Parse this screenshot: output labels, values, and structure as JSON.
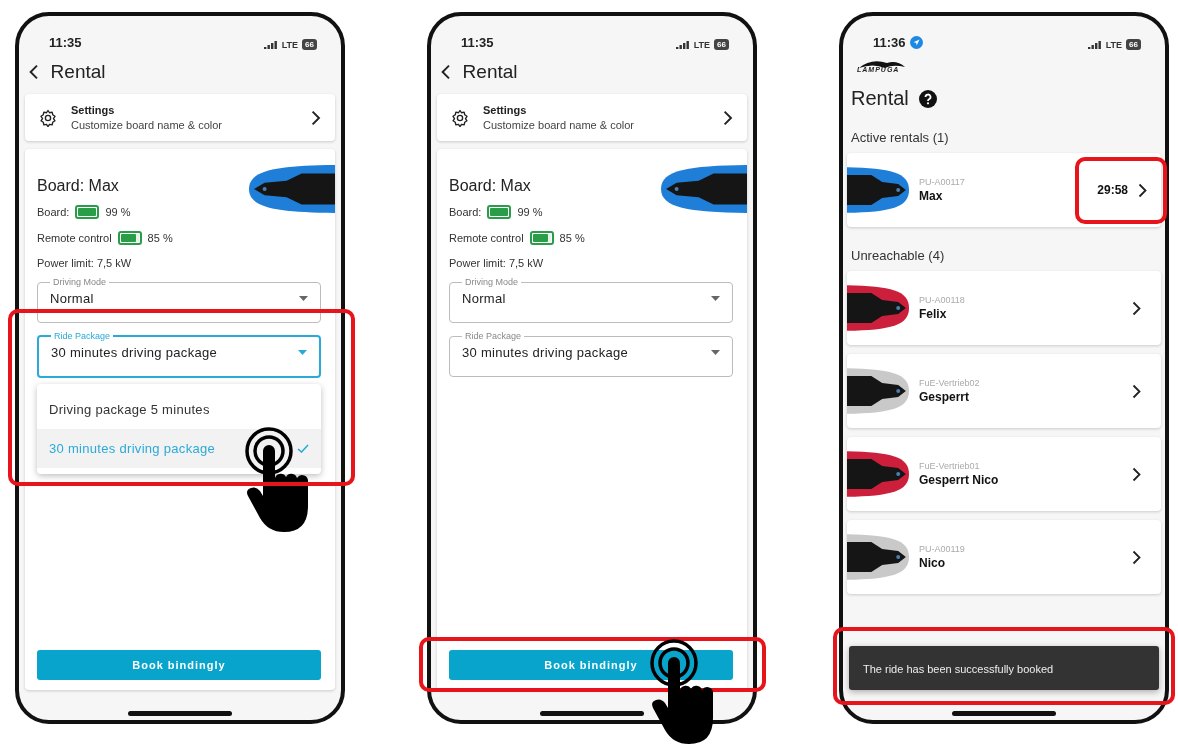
{
  "screens": [
    {
      "kind": "detail",
      "status": {
        "time": "11:35",
        "network": "LTE",
        "battery": "66"
      },
      "header": {
        "title": "Rental"
      },
      "settings": {
        "title": "Settings",
        "subtitle": "Customize board name & color"
      },
      "board": {
        "title": "Board: Max",
        "color": "#1f7fd8",
        "batteries": [
          {
            "label": "Board:",
            "level": 0.99,
            "reading": "99 %"
          },
          {
            "label": "Remote control",
            "level": 0.85,
            "reading": "85 %"
          }
        ],
        "power": "Power limit: 7,5 kW"
      },
      "fields": [
        {
          "label": "Driving Mode",
          "value": "Normal",
          "focused": false
        },
        {
          "label": "Ride Package",
          "value": "30 minutes driving package",
          "focused": true,
          "highlighted": true
        }
      ],
      "menu": [
        {
          "label": "Driving package 5 minutes",
          "selected": false
        },
        {
          "label": "30 minutes driving package",
          "selected": true,
          "tapped": true
        }
      ],
      "book_button": {
        "label": "Book bindingly"
      }
    },
    {
      "kind": "detail",
      "status": {
        "time": "11:35",
        "network": "LTE",
        "battery": "66"
      },
      "header": {
        "title": "Rental"
      },
      "settings": {
        "title": "Settings",
        "subtitle": "Customize board name & color"
      },
      "board": {
        "title": "Board: Max",
        "color": "#1f7fd8",
        "batteries": [
          {
            "label": "Board:",
            "level": 0.99,
            "reading": "99 %"
          },
          {
            "label": "Remote control",
            "level": 0.85,
            "reading": "85 %"
          }
        ],
        "power": "Power limit: 7,5 kW"
      },
      "fields": [
        {
          "label": "Driving Mode",
          "value": "Normal",
          "focused": false
        },
        {
          "label": "Ride Package",
          "value": "30 minutes driving package",
          "focused": false
        }
      ],
      "book_button": {
        "label": "Book bindingly",
        "highlighted": true,
        "tapped": true
      }
    },
    {
      "kind": "list",
      "status": {
        "time": "11:36",
        "location": true,
        "network": "LTE",
        "battery": "66"
      },
      "logo": "LAMPUGA",
      "title": "Rental",
      "sections": [
        {
          "title": "Active rentals (1)",
          "items": [
            {
              "id": "PU-A00117",
              "name": "Max",
              "color": "#1f7fd8",
              "timer": "29:58",
              "highlighted": true
            }
          ]
        },
        {
          "title": "Unreachable (4)",
          "items": [
            {
              "id": "PU-A00118",
              "name": "Felix",
              "color": "#cc1f3c"
            },
            {
              "id": "FuE-Vertrieb02",
              "name": "Gesperrt",
              "color": "#c9c9c9"
            },
            {
              "id": "FuE-Vertrieb01",
              "name": "Gesperrt Nico",
              "color": "#cc1f3c"
            },
            {
              "id": "PU-A00119",
              "name": "Nico",
              "color": "#c9c9c9"
            }
          ]
        }
      ],
      "toast": {
        "text": "The ride has been successfully booked",
        "highlighted": true
      }
    }
  ]
}
